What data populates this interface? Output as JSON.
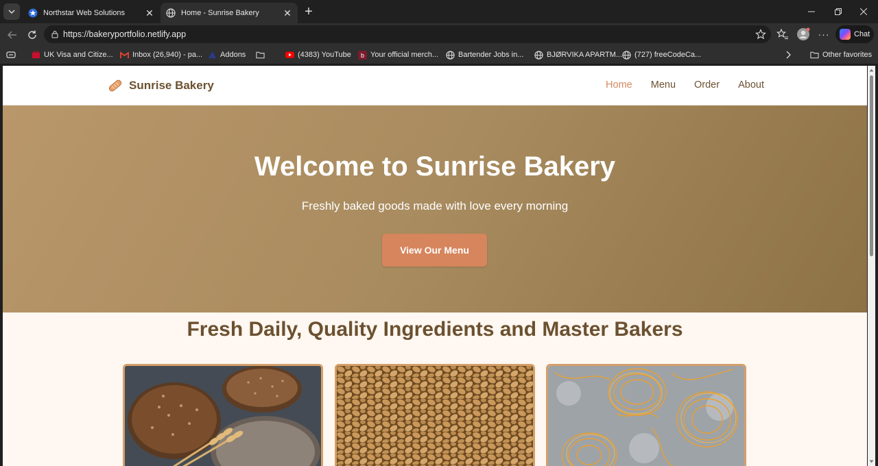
{
  "browser": {
    "tabs": [
      {
        "title": "Northstar Web Solutions",
        "active": false
      },
      {
        "title": "Home - Sunrise Bakery",
        "active": true
      }
    ],
    "address": {
      "url": "https://bakeryportfolio.netlify.app"
    },
    "chat_label": "Chat",
    "bookmarks": [
      {
        "label": "UK Visa and Citize..."
      },
      {
        "label": "Inbox (26,940) - pa..."
      },
      {
        "label": "Addons"
      },
      {
        "label": ""
      },
      {
        "label": "(4383) YouTube"
      },
      {
        "label": "Your official merch..."
      },
      {
        "label": "Bartender Jobs in..."
      },
      {
        "label": "BJØRVIKA APARTM..."
      },
      {
        "label": "(727) freeCodeCa..."
      }
    ],
    "other_favorites": "Other favorites"
  },
  "site": {
    "brand": "Sunrise Bakery",
    "nav": [
      {
        "label": "Home",
        "current": true
      },
      {
        "label": "Menu",
        "current": false
      },
      {
        "label": "Order",
        "current": false
      },
      {
        "label": "About",
        "current": false
      }
    ],
    "hero": {
      "title": "Welcome to Sunrise Bakery",
      "subtitle": "Freshly baked goods made with love every morning",
      "cta": "View Our Menu"
    },
    "features_title": "Fresh Daily, Quality Ingredients and Master Bakers"
  },
  "colors": {
    "accent": "#d4885e",
    "brand_brown": "#6b5130",
    "hero_gradient_start": "#b9976a",
    "hero_gradient_end": "#8d7246",
    "page_bg": "#fff7f1",
    "card_border": "#d4a06a"
  }
}
